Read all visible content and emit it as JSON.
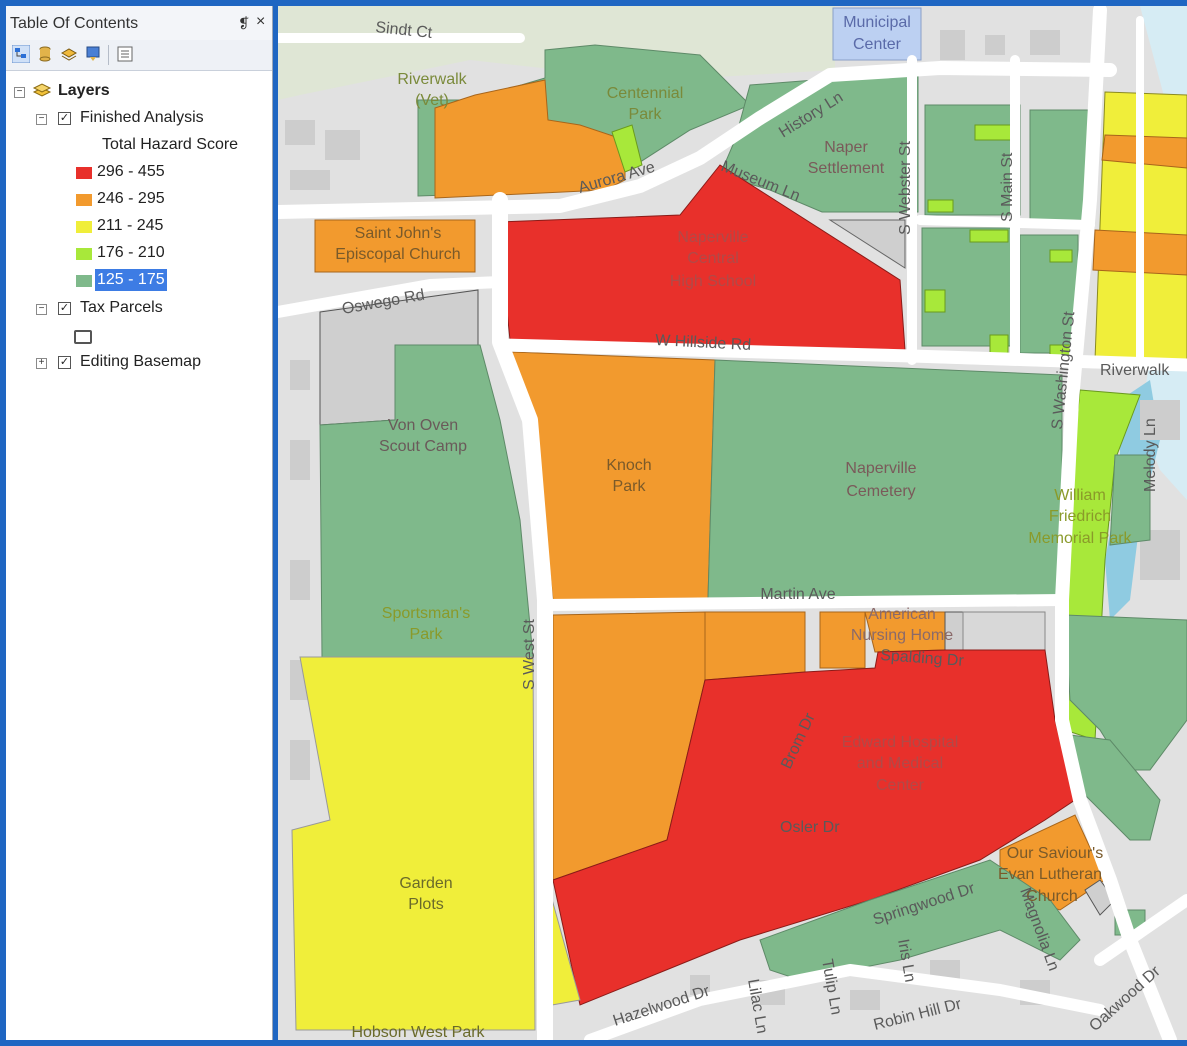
{
  "toc": {
    "title": "Table Of Contents",
    "pin": "❡",
    "close": "×",
    "root": {
      "label": "Layers",
      "expander": "−"
    },
    "finished": {
      "label": "Finished Analysis",
      "expander": "−",
      "checked": "✓",
      "field": "Total Hazard Score"
    },
    "classes": [
      {
        "label": "296 - 455",
        "color": "#e8302b"
      },
      {
        "label": "246 - 295",
        "color": "#f29a2e"
      },
      {
        "label": "211 - 245",
        "color": "#f0ee3a"
      },
      {
        "label": "176 - 210",
        "color": "#a8e83a"
      },
      {
        "label": "125 - 175",
        "color": "#7fb98b"
      }
    ],
    "tax": {
      "label": "Tax Parcels",
      "expander": "−",
      "checked": "✓"
    },
    "basemap": {
      "label": "Editing Basemap",
      "expander": "+",
      "checked": "✓"
    }
  },
  "map": {
    "labels": {
      "sindt": "Sindt Ct",
      "municipal1": "Municipal",
      "municipal2": "Center",
      "riverwalk1": "Riverwalk",
      "riverwalk2": "(Vet)",
      "centennial1": "Centennial",
      "centennial2": "Park",
      "history": "History Ln",
      "naper1": "Naper",
      "naper2": "Settlement",
      "aurora": "Aurora Ave",
      "museum": "Museum Ln",
      "webster": "S Webster St",
      "main": "S Main St",
      "stjohn1": "Saint John's",
      "stjohn2": "Episcopal Church",
      "nchs1": "Naperville",
      "nchs2": "Central",
      "nchs3": "High School",
      "oswego": "Oswego Rd",
      "washington": "S Washington St",
      "hillside": "W Hillside Rd",
      "riverwalk3": "Riverwalk",
      "vonoven1": "Von Oven",
      "vonoven2": "Scout Camp",
      "knoch1": "Knoch",
      "knoch2": "Park",
      "cemetery1": "Naperville",
      "cemetery2": "Cemetery",
      "william1": "William",
      "william2": "Friedrich",
      "william3": "Memorial Park",
      "melody": "Melody Ln",
      "martin": "Martin Ave",
      "sportsman1": "Sportsman's",
      "sportsman2": "Park",
      "westst": "S West St",
      "nursing1": "American",
      "nursing2": "Nursing Home",
      "spalding": "Spalding Dr",
      "brom": "Brom Dr",
      "hospital1": "Edward Hospital",
      "hospital2": "and Medical",
      "hospital3": "Center",
      "osler": "Osler Dr",
      "garden1": "Garden",
      "garden2": "Plots",
      "church1": "Our Saviour's",
      "church2": "Evan Lutheran",
      "church3": "Church",
      "springwood": "Springwood Dr",
      "magnolia": "Magnolia Ln",
      "iris": "Iris Ln",
      "tulip": "Tulip Ln",
      "lilac": "Lilac Ln",
      "hazelwood": "Hazelwood Dr",
      "robinhill": "Robin Hill Dr",
      "oakwood": "Oakwood Dr",
      "hobson": "Hobson West Park"
    }
  }
}
